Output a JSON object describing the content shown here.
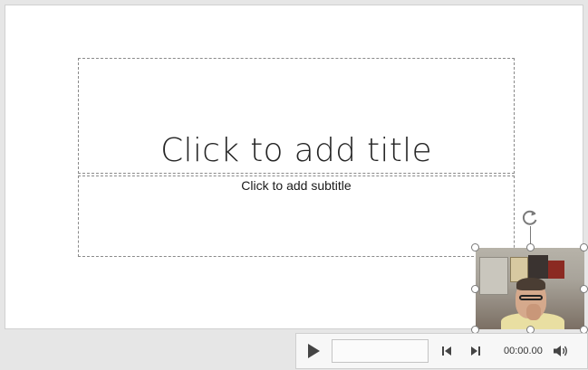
{
  "slide": {
    "title_placeholder": "Click to add title",
    "subtitle_placeholder": "Click to add subtitle"
  },
  "media": {
    "kind": "video-frame",
    "handle_color": "#7a7a7a"
  },
  "player": {
    "time": "00:00.00",
    "play_icon": "play-icon",
    "back_icon": "step-back-icon",
    "forward_icon": "step-forward-icon",
    "volume_icon": "volume-icon",
    "progress": 0
  },
  "colors": {
    "background": "#e6e6e6",
    "slide": "#ffffff",
    "icon": "#444444"
  }
}
